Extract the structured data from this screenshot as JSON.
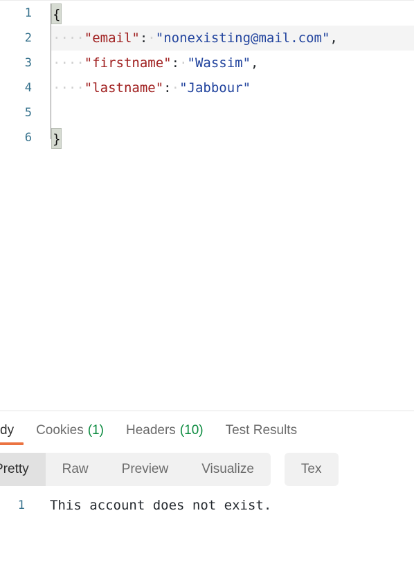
{
  "request_editor": {
    "language": "json",
    "whitespace_dot": "·",
    "lines": [
      {
        "number": "1",
        "active": false,
        "indent": "",
        "tokens": [
          {
            "type": "brace",
            "text": "{"
          }
        ]
      },
      {
        "number": "2",
        "active": true,
        "indent": "····",
        "tokens": [
          {
            "type": "key",
            "text": "\"email\""
          },
          {
            "type": "punc",
            "text": ":"
          },
          {
            "type": "ws",
            "text": "·"
          },
          {
            "type": "str",
            "text": "\"nonexisting@mail.com\""
          },
          {
            "type": "punc",
            "text": ","
          }
        ]
      },
      {
        "number": "3",
        "active": false,
        "indent": "····",
        "tokens": [
          {
            "type": "key",
            "text": "\"firstname\""
          },
          {
            "type": "punc",
            "text": ":"
          },
          {
            "type": "ws",
            "text": "·"
          },
          {
            "type": "str",
            "text": "\"Wassim\""
          },
          {
            "type": "punc",
            "text": ","
          }
        ]
      },
      {
        "number": "4",
        "active": false,
        "indent": "····",
        "tokens": [
          {
            "type": "key",
            "text": "\"lastname\""
          },
          {
            "type": "punc",
            "text": ":"
          },
          {
            "type": "ws",
            "text": "·"
          },
          {
            "type": "str",
            "text": "\"Jabbour\""
          }
        ]
      },
      {
        "number": "5",
        "active": false,
        "indent": "",
        "tokens": []
      },
      {
        "number": "6",
        "active": false,
        "indent": "",
        "tokens": [
          {
            "type": "brace",
            "text": "}"
          }
        ]
      }
    ]
  },
  "response": {
    "tabs": [
      {
        "id": "body",
        "label": "dy",
        "count": null,
        "active": true
      },
      {
        "id": "cookies",
        "label": "Cookies",
        "count": "(1)",
        "active": false
      },
      {
        "id": "headers",
        "label": "Headers",
        "count": "(10)",
        "active": false
      },
      {
        "id": "test-results",
        "label": "Test Results",
        "count": null,
        "active": false
      }
    ],
    "format_tabs": [
      {
        "id": "pretty",
        "label": "Pretty",
        "active": true
      },
      {
        "id": "raw",
        "label": "Raw",
        "active": false
      },
      {
        "id": "preview",
        "label": "Preview",
        "active": false
      },
      {
        "id": "visualize",
        "label": "Visualize",
        "active": false
      }
    ],
    "type_selector": {
      "id": "text",
      "label": "Tex"
    },
    "body_lines": [
      {
        "number": "1",
        "text": "This account does not exist."
      }
    ]
  },
  "colors": {
    "accent_orange": "#eb7341",
    "count_green": "#0a8a3e",
    "line_number_blue": "#35718c",
    "json_key_red": "#a02020",
    "json_string_blue": "#22449e",
    "active_line_gray": "#f4f4f4",
    "pill_bg": "#f1f1f1",
    "pill_active_bg": "#e1e1e1"
  }
}
